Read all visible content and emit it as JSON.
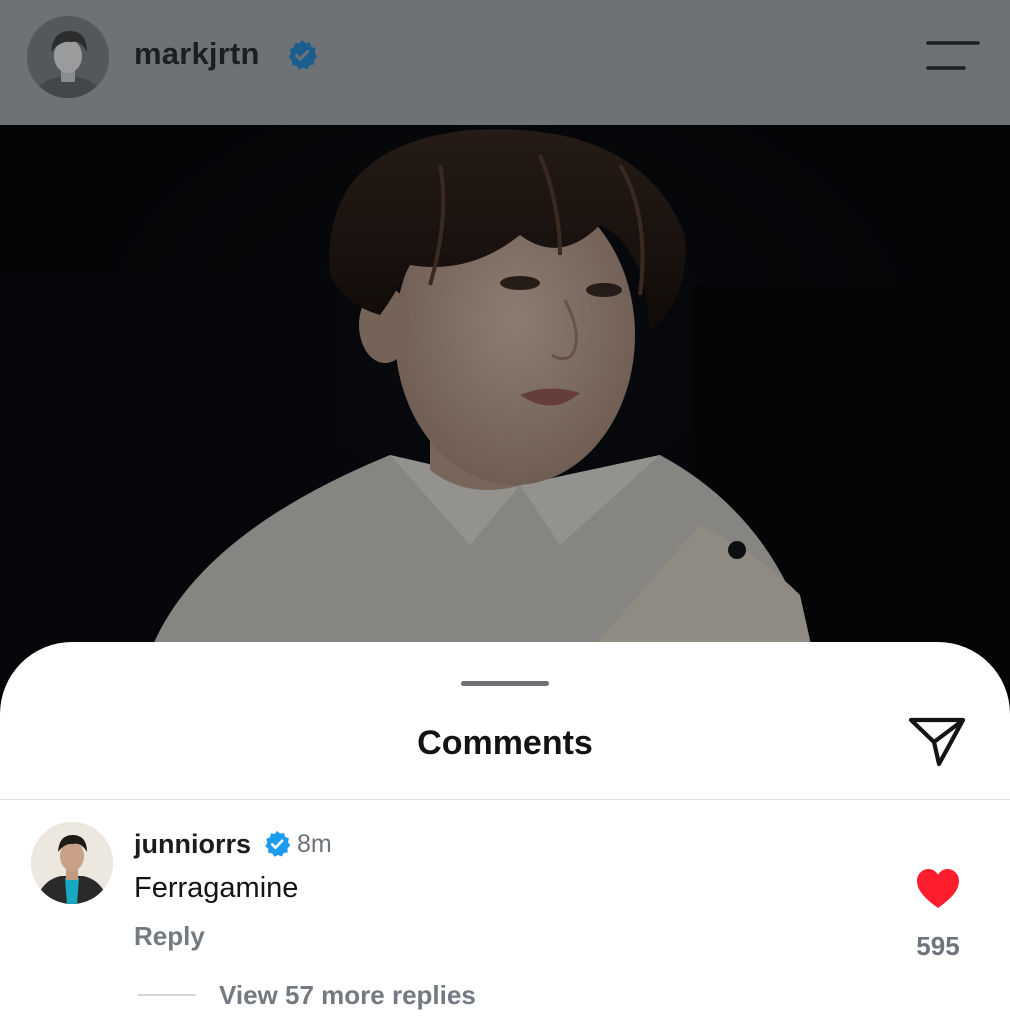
{
  "header": {
    "username": "markjrtn",
    "verified": true,
    "avatar_icon": "profile-photo",
    "menu_icon": "menu-icon"
  },
  "post": {
    "image_icon": "portrait-photo"
  },
  "comments_sheet": {
    "title": "Comments",
    "share_icon": "send-icon",
    "comments": [
      {
        "username": "junniorrs",
        "verified": true,
        "time": "8m",
        "text": "Ferragamine",
        "reply_label": "Reply",
        "liked": true,
        "likes": "595",
        "view_more": "View 57 more replies"
      }
    ]
  },
  "colors": {
    "verified_blue": "#1d9bf0",
    "heart_red": "#ff1e2e",
    "overlay_gray": "#6f7275"
  }
}
